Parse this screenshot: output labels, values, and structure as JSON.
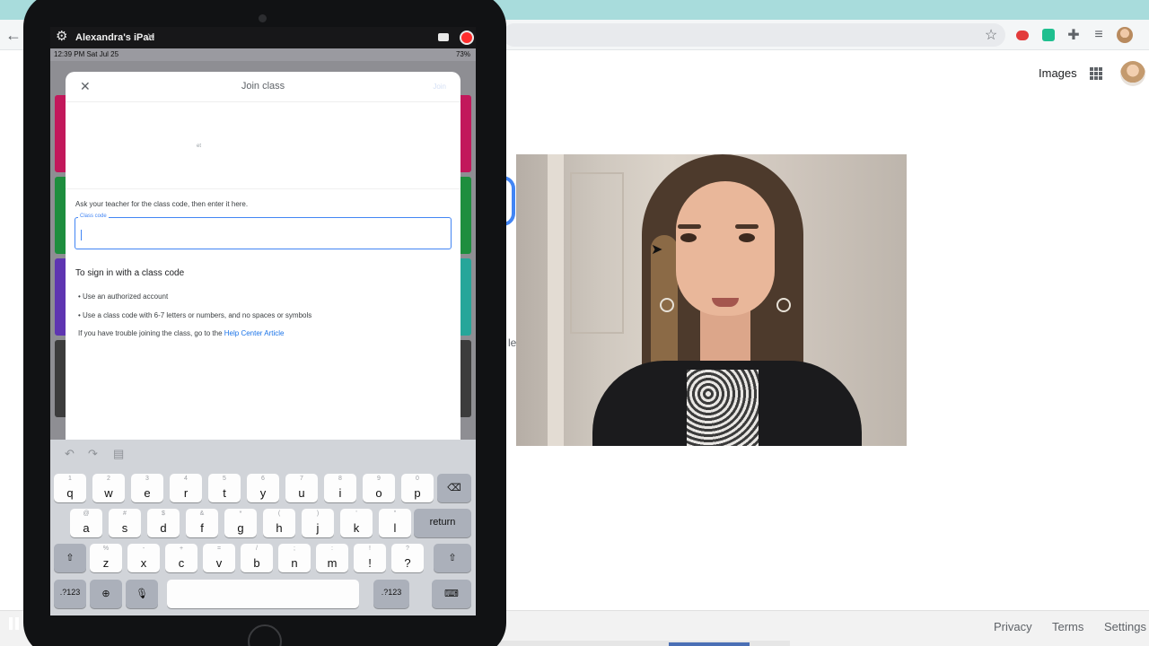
{
  "browser": {
    "images_link": "Images",
    "footer": {
      "privacy": "Privacy",
      "terms": "Terms",
      "settings": "Settings"
    },
    "partial_text": "le"
  },
  "quicktime": {
    "title": "Alexandra's iPad"
  },
  "ipad": {
    "status": {
      "time": "12:39 PM  Sat Jul 25",
      "right": "73%"
    },
    "dialog": {
      "title": "Join class",
      "join_button": "Join",
      "account_hint": "et",
      "instruction": "Ask your teacher for the class code, then enter it here.",
      "field_label": "Class code",
      "field_value": "",
      "signin_heading": "To sign in with a class code",
      "bullets": [
        "Use an authorized account",
        "Use a class code with 6-7 letters or numbers, and no spaces or symbols"
      ],
      "trouble_prefix": "If you have trouble joining the class, go to the ",
      "help_link": "Help Center Article"
    },
    "keyboard": {
      "row1": [
        [
          "1",
          "q"
        ],
        [
          "2",
          "w"
        ],
        [
          "3",
          "e"
        ],
        [
          "4",
          "r"
        ],
        [
          "5",
          "t"
        ],
        [
          "6",
          "y"
        ],
        [
          "7",
          "u"
        ],
        [
          "8",
          "i"
        ],
        [
          "9",
          "o"
        ],
        [
          "0",
          "p"
        ]
      ],
      "row2": [
        [
          "@",
          "a"
        ],
        [
          "#",
          "s"
        ],
        [
          "$",
          "d"
        ],
        [
          "&",
          "f"
        ],
        [
          "*",
          "g"
        ],
        [
          "(",
          "h"
        ],
        [
          ")",
          "j"
        ],
        [
          "'",
          "k"
        ],
        [
          "\"",
          "l"
        ]
      ],
      "row3": [
        [
          "%",
          "z"
        ],
        [
          "-",
          "x"
        ],
        [
          "+",
          "c"
        ],
        [
          "=",
          "v"
        ],
        [
          "/",
          "b"
        ],
        [
          ";",
          "n"
        ],
        [
          ":",
          "m"
        ],
        [
          "!",
          "!"
        ],
        [
          "?",
          "?"
        ]
      ],
      "return": "return",
      "numbers_left": ".?123",
      "numbers_right": ".?123"
    }
  },
  "colors": {
    "accent": "#4285f4",
    "link": "#1a73e8",
    "record": "#ff2d2d",
    "tab_strip": "#a8dcdc"
  }
}
